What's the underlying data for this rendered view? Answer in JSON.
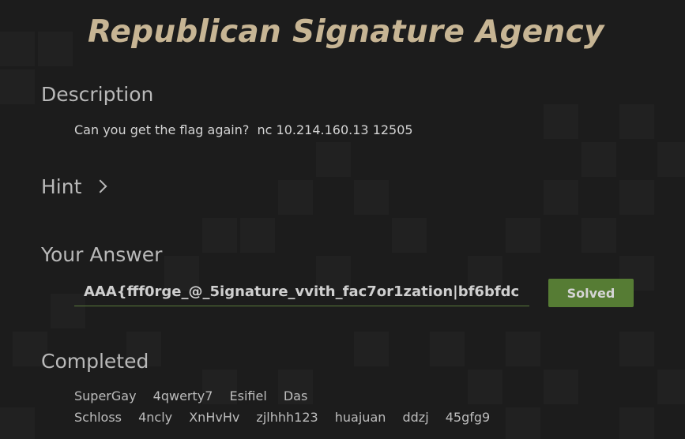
{
  "page": {
    "title": "Republican Signature Agency"
  },
  "description": {
    "heading": "Description",
    "text": "Can you get the flag again?  nc 10.214.160.13 12505"
  },
  "hint": {
    "heading": "Hint",
    "icon": "chevron-right-icon"
  },
  "answer": {
    "heading": "Your Answer",
    "value": "AAA{fff0rge_@_5ignature_vvith_fac7or1zation|bf6bfdc",
    "button_label": "Solved",
    "button_color": "#567c34"
  },
  "completed": {
    "heading": "Completed",
    "solvers_row1": [
      "SuperGay",
      "4qwerty7",
      "Esifiel",
      "Das"
    ],
    "solvers_row2": [
      "Schloss",
      "4ncly",
      "XnHvHv",
      "zjlhhh123",
      "huajuan",
      "ddzj",
      "45gfg9"
    ]
  },
  "colors": {
    "title": "#c7b594",
    "background": "#1c1c1c"
  }
}
